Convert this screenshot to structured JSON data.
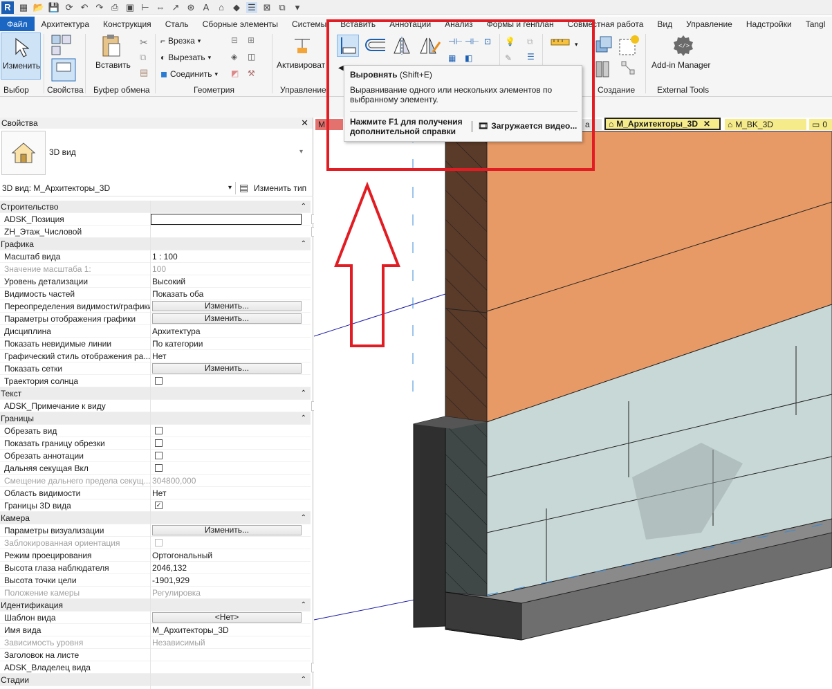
{
  "app": {
    "logo": "R"
  },
  "ribbon_tabs": [
    "Файл",
    "Архитектура",
    "Конструкция",
    "Сталь",
    "Сборные элементы",
    "Системы",
    "Вставить",
    "Аннотации",
    "Анализ",
    "Формы и генплан",
    "Совместная работа",
    "Вид",
    "Управление",
    "Надстройки",
    "Tangl"
  ],
  "ribbon": {
    "select": {
      "modify_label": "Изменить",
      "panel": "Выбор"
    },
    "properties": {
      "panel": "Свойства"
    },
    "clipboard": {
      "paste_label": "Вставить",
      "panel": "Буфер обмена"
    },
    "geometry": {
      "cope_label": "Врезка",
      "cut_label": "Вырезать",
      "join_label": "Соединить",
      "panel": "Геометрия"
    },
    "control": {
      "activate_label": "Активироват",
      "panel": "Управление"
    },
    "create": {
      "panel": "Создание"
    },
    "external": {
      "addin_label": "Add-in Manager",
      "panel": "External Tools"
    }
  },
  "tooltip": {
    "title": "Выровнять",
    "shortcut": "(Shift+E)",
    "description": "Выравнивание одного или нескольких элементов по выбранному элементу.",
    "help": "Нажмите F1 для получения дополнительной справки",
    "video": "Загружается видео..."
  },
  "view_tabs": {
    "m_label": "M",
    "a_label": "а",
    "active": "M_Архитекторы_3D",
    "second": "M_BK_3D",
    "third": "0"
  },
  "properties": {
    "title": "Свойства",
    "type_name": "3D вид",
    "instance_selector": "3D вид: M_Архитекторы_3D",
    "edit_type": "Изменить тип",
    "rows": [
      {
        "kind": "cat",
        "label": "Строительство"
      },
      {
        "kind": "input",
        "label": "ADSK_Позиция",
        "value": "",
        "scroll": true
      },
      {
        "kind": "text",
        "label": "ZH_Этаж_Числовой",
        "value": "",
        "scroll": true
      },
      {
        "kind": "cat",
        "label": "Графика"
      },
      {
        "kind": "text",
        "label": "Масштаб вида",
        "value": "1 : 100"
      },
      {
        "kind": "text",
        "dim": true,
        "label": "Значение масштаба    1:",
        "value": "100"
      },
      {
        "kind": "text",
        "label": "Уровень детализации",
        "value": "Высокий"
      },
      {
        "kind": "text",
        "label": "Видимость частей",
        "value": "Показать оба"
      },
      {
        "kind": "button",
        "label": "Переопределения видимости/графики",
        "value": "Изменить..."
      },
      {
        "kind": "button",
        "label": "Параметры отображения графики",
        "value": "Изменить..."
      },
      {
        "kind": "text",
        "label": "Дисциплина",
        "value": "Архитектура"
      },
      {
        "kind": "text",
        "label": "Показать невидимые линии",
        "value": "По категории"
      },
      {
        "kind": "text",
        "label": "Графический стиль отображения ра...",
        "value": "Нет"
      },
      {
        "kind": "button",
        "label": "Показать сетки",
        "value": "Изменить..."
      },
      {
        "kind": "check",
        "label": "Траектория солнца",
        "checked": false
      },
      {
        "kind": "cat",
        "label": "Текст"
      },
      {
        "kind": "text",
        "label": "ADSK_Примечание к виду",
        "value": "",
        "scroll": true
      },
      {
        "kind": "cat",
        "label": "Границы"
      },
      {
        "kind": "check",
        "label": "Обрезать вид",
        "checked": false
      },
      {
        "kind": "check",
        "label": "Показать границу обрезки",
        "checked": false
      },
      {
        "kind": "check",
        "label": "Обрезать аннотации",
        "checked": false
      },
      {
        "kind": "check",
        "label": "Дальняя секущая Вкл",
        "checked": false
      },
      {
        "kind": "text",
        "dim": true,
        "label": "Смещение дальнего предела секущ...",
        "value": "304800,000"
      },
      {
        "kind": "text",
        "label": "Область видимости",
        "value": "Нет"
      },
      {
        "kind": "check",
        "label": "Границы 3D вида",
        "checked": true
      },
      {
        "kind": "cat",
        "label": "Камера"
      },
      {
        "kind": "button",
        "label": "Параметры визуализации",
        "value": "Изменить..."
      },
      {
        "kind": "check",
        "dim": true,
        "label": "Заблокированная ориентация",
        "checked": false
      },
      {
        "kind": "text",
        "label": "Режим проецирования",
        "value": "Ортогональный"
      },
      {
        "kind": "text",
        "label": "Высота глаза наблюдателя",
        "value": "2046,132"
      },
      {
        "kind": "text",
        "label": "Высота точки цели",
        "value": "-1901,929"
      },
      {
        "kind": "text",
        "dim": true,
        "label": "Положение камеры",
        "value": "Регулировка"
      },
      {
        "kind": "cat",
        "label": "Идентификация"
      },
      {
        "kind": "button",
        "label": "Шаблон вида",
        "value": "<Нет>"
      },
      {
        "kind": "text",
        "label": "Имя вида",
        "value": "M_Архитекторы_3D"
      },
      {
        "kind": "text",
        "dim": true,
        "label": "Зависимость уровня",
        "value": "Независимый"
      },
      {
        "kind": "text",
        "label": "Заголовок на листе",
        "value": ""
      },
      {
        "kind": "text",
        "label": "ADSK_Владелец вида",
        "value": "",
        "scroll": true
      },
      {
        "kind": "cat",
        "label": "Стадии"
      }
    ]
  },
  "colors": {
    "accent": "#1a66c2",
    "highlight": "#e11d23",
    "brick": "#e89a66",
    "block": "#c8d8d6",
    "wood": "#5a3a28",
    "concrete": "#3a3a3a"
  }
}
